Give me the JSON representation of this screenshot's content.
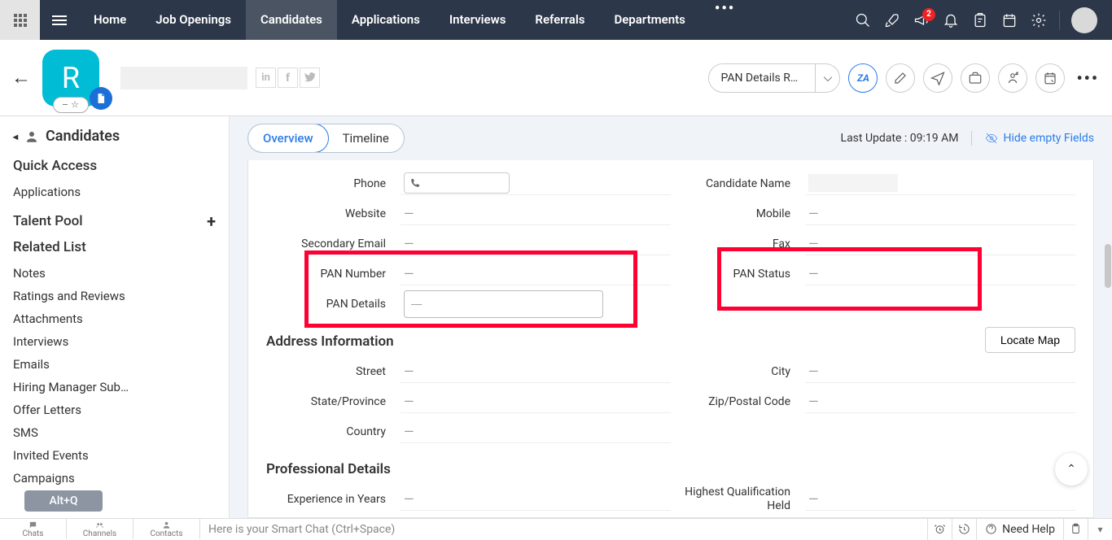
{
  "topnav": {
    "items": [
      "Home",
      "Job Openings",
      "Candidates",
      "Applications",
      "Interviews",
      "Referrals",
      "Departments"
    ],
    "active_index": 2,
    "notifications_count": "2"
  },
  "header": {
    "avatar_letter": "R",
    "rating_text": "--",
    "action_dropdown": "PAN Details Retri…",
    "za_label": "ZA"
  },
  "sidebar": {
    "title": "Candidates",
    "groups": [
      {
        "title": "Quick Access",
        "items": [
          "Applications"
        ]
      },
      {
        "title": "Talent Pool",
        "items": []
      },
      {
        "title": "Related List",
        "items": [
          "Notes",
          "Ratings and Reviews",
          "Attachments",
          "Interviews",
          "Emails",
          "Hiring Manager Sub…",
          "Offer Letters",
          "SMS",
          "Invited Events",
          "Campaigns"
        ]
      }
    ],
    "altq": "Alt+Q"
  },
  "content": {
    "tabs": [
      "Overview",
      "Timeline"
    ],
    "active_tab": 0,
    "last_update_label": "Last Update :",
    "last_update_time": "09:19 AM",
    "hide_fields": "Hide empty Fields",
    "locate_map": "Locate Map",
    "empty": "—",
    "sections": {
      "basic": {
        "left": [
          {
            "label": "Phone",
            "value": "",
            "type": "phone"
          },
          {
            "label": "Website",
            "value": "—"
          },
          {
            "label": "Secondary Email",
            "value": "—"
          },
          {
            "label": "PAN Number",
            "value": "—"
          },
          {
            "label": "PAN Details",
            "value": "—",
            "type": "input"
          }
        ],
        "right": [
          {
            "label": "Candidate Name",
            "value": ""
          },
          {
            "label": "Mobile",
            "value": "—"
          },
          {
            "label": "Fax",
            "value": "—"
          },
          {
            "label": "PAN Status",
            "value": "—"
          }
        ]
      },
      "address": {
        "title": "Address Information",
        "left": [
          {
            "label": "Street",
            "value": "—"
          },
          {
            "label": "State/Province",
            "value": "—"
          },
          {
            "label": "Country",
            "value": "—"
          }
        ],
        "right": [
          {
            "label": "City",
            "value": "—"
          },
          {
            "label": "Zip/Postal Code",
            "value": "—"
          }
        ]
      },
      "professional": {
        "title": "Professional Details",
        "left": [
          {
            "label": "Experience in Years",
            "value": "—"
          }
        ],
        "right": [
          {
            "label": "Highest Qualification Held",
            "value": "—"
          }
        ]
      }
    }
  },
  "footer": {
    "tabs": [
      "Chats",
      "Channels",
      "Contacts"
    ],
    "smart_chat": "Here is your Smart Chat (Ctrl+Space)",
    "need_help": "Need Help"
  }
}
